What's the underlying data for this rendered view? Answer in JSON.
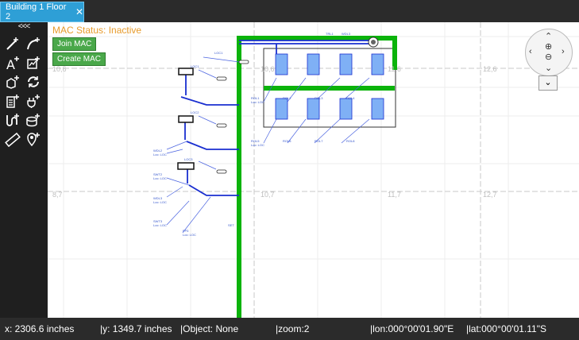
{
  "tab": {
    "title": "Building 1 Floor 2",
    "close": "✕"
  },
  "toolbar": {
    "collapse": "<<<"
  },
  "mac": {
    "status": "MAC Status: Inactive",
    "join": "Join MAC",
    "create": "Create MAC"
  },
  "grid_labels": [
    "10,6",
    "11,6",
    "12,6",
    "8,7",
    "10,7",
    "11,7",
    "12,7"
  ],
  "status": {
    "x": "x: 2306.6 inches",
    "y": "|y: 1349.7 inches",
    "object": "|Object: None",
    "zoom": "|zoom:2",
    "lon": "|lon:000°00'01.90\"E",
    "lat": "|lat:000°00'01.11\"S"
  },
  "colors": {
    "accent": "#2e9fd6",
    "mac_status": "#e79b2c",
    "button": "#4aa84a",
    "cable": "#0bb30b",
    "link": "#1a2fd0",
    "device": "#7fb0f5"
  }
}
